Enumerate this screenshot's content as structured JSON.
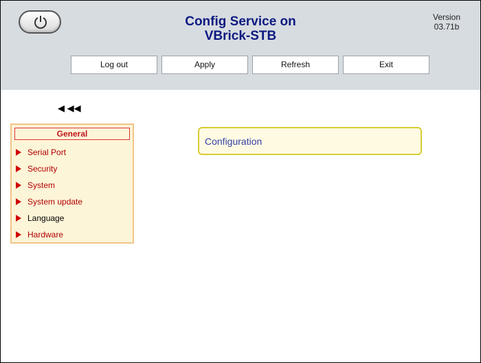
{
  "header": {
    "title_line1": "Config Service on",
    "title_line2": "VBrick-STB",
    "version_label": "Version",
    "version_value": "03.71b"
  },
  "toolbar": {
    "logout_label": "Log out",
    "apply_label": "Apply",
    "refresh_label": "Refresh",
    "exit_label": "Exit"
  },
  "nav": {
    "arrows": "◀ ◀◀"
  },
  "menu": {
    "heading": "General",
    "items": [
      {
        "label": "Serial Port"
      },
      {
        "label": "Security"
      },
      {
        "label": "System"
      },
      {
        "label": "System update"
      },
      {
        "label": "Language"
      },
      {
        "label": "Hardware"
      }
    ]
  },
  "main": {
    "section_label": "Configuration"
  },
  "colors": {
    "header_bg": "#d7dce1",
    "title": "#0d1a80",
    "menu_bg": "#fdf5d8",
    "menu_heading": "#c0141b",
    "accent_red": "#d00000",
    "config_border": "#d9cc33"
  }
}
